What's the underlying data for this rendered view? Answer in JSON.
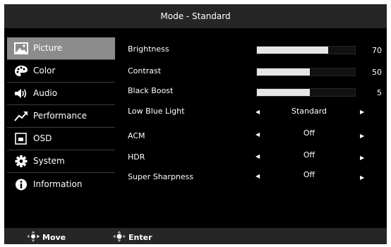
{
  "title": "Mode - Standard",
  "sidebar": {
    "items": [
      {
        "label": "Picture",
        "icon": "picture-icon",
        "active": true
      },
      {
        "label": "Color",
        "icon": "palette-icon"
      },
      {
        "label": "Audio",
        "icon": "speaker-icon"
      },
      {
        "label": "Performance",
        "icon": "trend-arrow-icon"
      },
      {
        "label": "OSD",
        "icon": "osd-window-icon"
      },
      {
        "label": "System",
        "icon": "gear-icon"
      },
      {
        "label": "Information",
        "icon": "info-icon"
      }
    ]
  },
  "settings": {
    "brightness": {
      "label": "Brightness",
      "value": "70",
      "level": 0.73
    },
    "contrast": {
      "label": "Contrast",
      "value": "50",
      "level": 0.54
    },
    "black_boost": {
      "label": "Black Boost",
      "value": "5",
      "level": 0.54
    },
    "low_blue_light": {
      "label": "Low Blue Light",
      "value": "Standard"
    },
    "acm": {
      "label": "ACM",
      "value": "Off"
    },
    "hdr": {
      "label": "HDR",
      "value": "Off"
    },
    "super_sharpness": {
      "label": "Super Sharpness",
      "value": "Off"
    }
  },
  "footer": {
    "move_label": "Move",
    "enter_label": "Enter"
  },
  "colors": {
    "background": "#000000",
    "bar_fill": "#e6e6e6",
    "active_item": "#8c8c8c",
    "header": "#262626"
  }
}
